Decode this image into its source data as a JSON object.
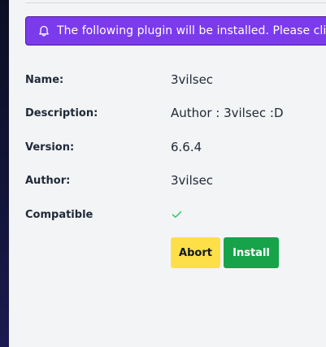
{
  "alert": {
    "message": "The following plugin will be installed. Please click \"In",
    "icon": "bell-icon",
    "color": "#7c3aed"
  },
  "plugin": {
    "fields": [
      {
        "label": "Name:",
        "value": "3vilsec"
      },
      {
        "label": "Description:",
        "value": "Author : 3vilsec :D"
      },
      {
        "label": "Version:",
        "value": "6.6.4"
      },
      {
        "label": "Author:",
        "value": "3vilsec"
      }
    ],
    "compatible_label": "Compatible",
    "compatible_icon": "check-icon",
    "compatible": true
  },
  "actions": {
    "abort_label": "Abort",
    "install_label": "Install",
    "abort_color": "#fde047",
    "install_color": "#16a34a"
  }
}
